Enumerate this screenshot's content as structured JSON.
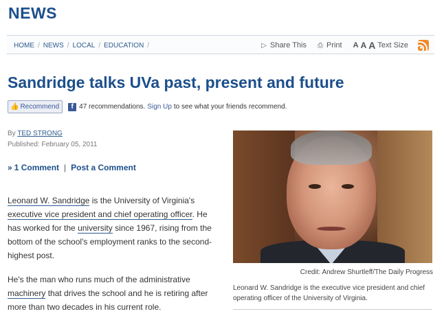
{
  "section": {
    "title": "NEWS"
  },
  "breadcrumb": [
    {
      "label": "HOME"
    },
    {
      "label": "NEWS"
    },
    {
      "label": "LOCAL"
    },
    {
      "label": "EDUCATION"
    }
  ],
  "tools": {
    "share_label": "Share This",
    "print_label": "Print",
    "text_size_a1": "A",
    "text_size_a2": "A",
    "text_size_a3": "A",
    "text_size_label": "Text Size",
    "icons": [
      "share-icon",
      "print-icon",
      "rss-icon"
    ]
  },
  "article": {
    "headline": "Sandridge talks UVa past, present and future",
    "facebook": {
      "button_label": "Recommend",
      "count_text": "47 recommendations.",
      "signup_link": "Sign Up",
      "signup_suffix": "to see what your friends recommend."
    },
    "byline_prefix": "By",
    "author": "TED STRONG",
    "published": "Published: February 05, 2011",
    "comments": {
      "count_label": "1 Comment",
      "separator": "|",
      "post_label": "Post a Comment"
    },
    "paragraphs": {
      "p1": {
        "link1": "Leonard W. Sandridge",
        "text1": " is the University of Virginia's ",
        "link2": "executive vice president and chief operating officer",
        "text2": ". He has worked for the ",
        "link3": "university",
        "text3": " since 1967, rising from the bottom of the school's employment ranks to the second-highest post."
      },
      "p2": {
        "text1": "He's the man who runs much of the administrative ",
        "link1": "machinery",
        "text2": " that drives the school and he is retiring after more than two decades in his current role."
      }
    },
    "photo": {
      "credit": "Credit: Andrew Shurtleff/The Daily Progress",
      "caption": "Leonard W. Sandridge is the executive vice president and chief operating officer of the University of Virginia."
    }
  },
  "colors": {
    "brand_blue": "#1c4f8c",
    "link_blue": "#2d5b8e",
    "facebook_blue": "#3b5998",
    "rss_orange": "#f0892a"
  }
}
